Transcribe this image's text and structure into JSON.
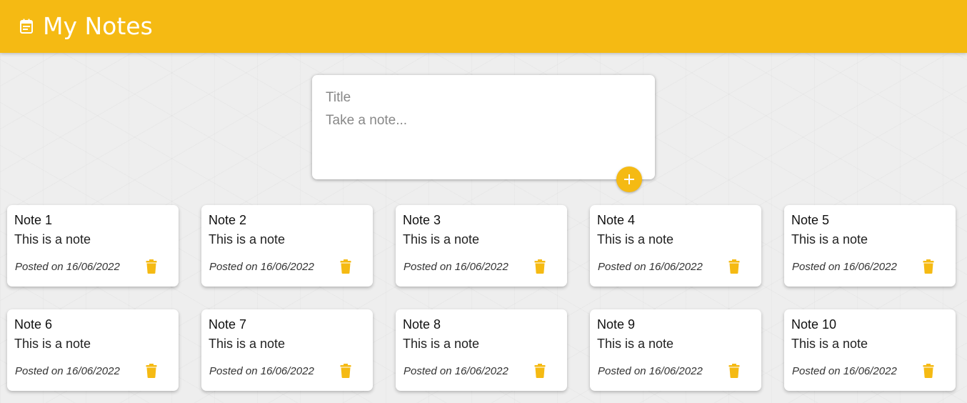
{
  "header": {
    "title": "My Notes",
    "icon": "calendar-note-icon"
  },
  "composer": {
    "title_placeholder": "Title",
    "content_placeholder": "Take a note...",
    "add_icon": "plus-icon"
  },
  "colors": {
    "accent": "#f5ba13",
    "background": "#eeeeee",
    "card": "#ffffff"
  },
  "notes": [
    {
      "title": "Note 1",
      "content": "This is a note",
      "date": "Posted on 16/06/2022",
      "delete_icon": "trash-icon"
    },
    {
      "title": "Note 2",
      "content": "This is a note",
      "date": "Posted on 16/06/2022",
      "delete_icon": "trash-icon"
    },
    {
      "title": "Note 3",
      "content": "This is a note",
      "date": "Posted on 16/06/2022",
      "delete_icon": "trash-icon"
    },
    {
      "title": "Note 4",
      "content": "This is a note",
      "date": "Posted on 16/06/2022",
      "delete_icon": "trash-icon"
    },
    {
      "title": "Note 5",
      "content": "This is a note",
      "date": "Posted on 16/06/2022",
      "delete_icon": "trash-icon"
    },
    {
      "title": "Note 6",
      "content": "This is a note",
      "date": "Posted on 16/06/2022",
      "delete_icon": "trash-icon"
    },
    {
      "title": "Note 7",
      "content": "This is a note",
      "date": "Posted on 16/06/2022",
      "delete_icon": "trash-icon"
    },
    {
      "title": "Note 8",
      "content": "This is a note",
      "date": "Posted on 16/06/2022",
      "delete_icon": "trash-icon"
    },
    {
      "title": "Note 9",
      "content": "This is a note",
      "date": "Posted on 16/06/2022",
      "delete_icon": "trash-icon"
    },
    {
      "title": "Note 10",
      "content": "This is a note",
      "date": "Posted on 16/06/2022",
      "delete_icon": "trash-icon"
    }
  ]
}
